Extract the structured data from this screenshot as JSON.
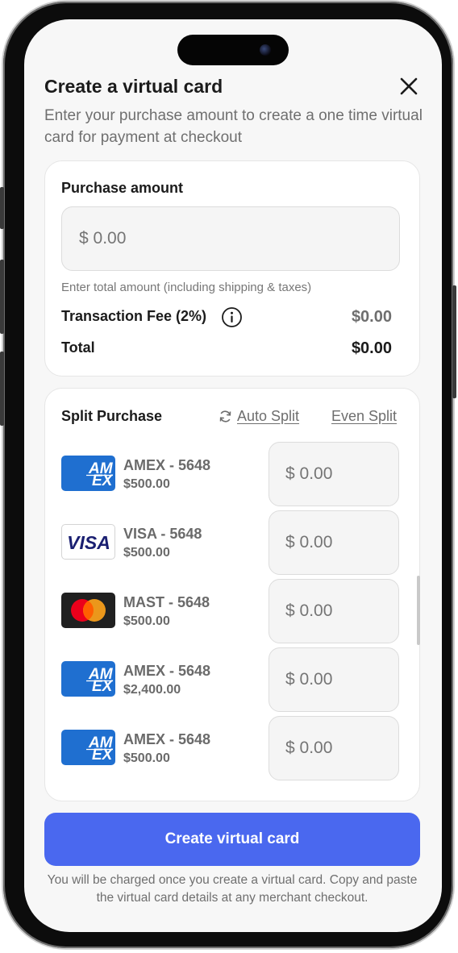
{
  "header": {
    "title": "Create a virtual card",
    "subtitle": "Enter your purchase amount to create a one time virtual card for payment at checkout"
  },
  "purchase": {
    "label": "Purchase amount",
    "placeholder": "$ 0.00",
    "hint": "Enter total amount (including shipping & taxes)",
    "fee_label": "Transaction Fee (2%)",
    "fee_value": "$0.00",
    "total_label": "Total",
    "total_value": "$0.00"
  },
  "split": {
    "title": "Split Purchase",
    "auto_split_label": "Auto Split",
    "even_split_label": "Even Split",
    "cards": [
      {
        "brand": "amex",
        "name": "AMEX - 5648",
        "balance": "$500.00",
        "placeholder": "$ 0.00"
      },
      {
        "brand": "visa",
        "name": "VISA - 5648",
        "balance": "$500.00",
        "placeholder": "$ 0.00"
      },
      {
        "brand": "mastercard",
        "name": "MAST - 5648",
        "balance": "$500.00",
        "placeholder": "$ 0.00"
      },
      {
        "brand": "amex",
        "name": "AMEX - 5648",
        "balance": "$2,400.00",
        "placeholder": "$ 0.00"
      },
      {
        "brand": "amex",
        "name": "AMEX - 5648",
        "balance": "$500.00",
        "placeholder": "$ 0.00"
      }
    ],
    "logo_text": {
      "amex_top": "AM",
      "amex_bottom": "EX",
      "visa": "VISA"
    }
  },
  "cta": {
    "label": "Create virtual card",
    "footnote": "You will be charged once you create a virtual card. Copy and paste the virtual card details at any merchant checkout."
  },
  "icons": {
    "close": "close-icon",
    "info": "info-icon",
    "refresh": "refresh-icon"
  },
  "colors": {
    "primary": "#4a68ef",
    "amex": "#1f6fd0",
    "visa": "#1a1f71",
    "mc_red": "#eb001b",
    "mc_orange": "#f79e1b"
  }
}
